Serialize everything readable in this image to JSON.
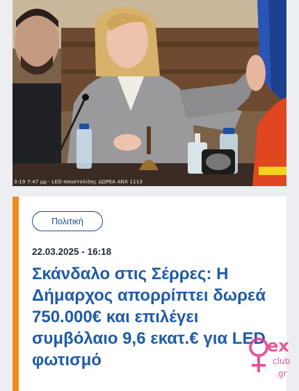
{
  "article": {
    "photo": {
      "ticker": "3:19 7:47 μμ · LED-Αποστολίδης ΔΩΡΕΑ ΑΝΧ 1113"
    },
    "category": "Πολιτική",
    "date": "22.03.2025 - 16:18",
    "headline": "Σκάνδαλο στις Σέρρες: Η Δήμαρχος απορρίπτει δωρεά 750.000€ και επιλέγει συμβόλαιο 9,6 εκατ.€ για LED φωτισμό",
    "accent_color": "#f08a1c",
    "headline_color": "#1e5ba7"
  },
  "watermark": {
    "text_top": "ex",
    "text_bottom": "club",
    "suffix": ".gr"
  }
}
